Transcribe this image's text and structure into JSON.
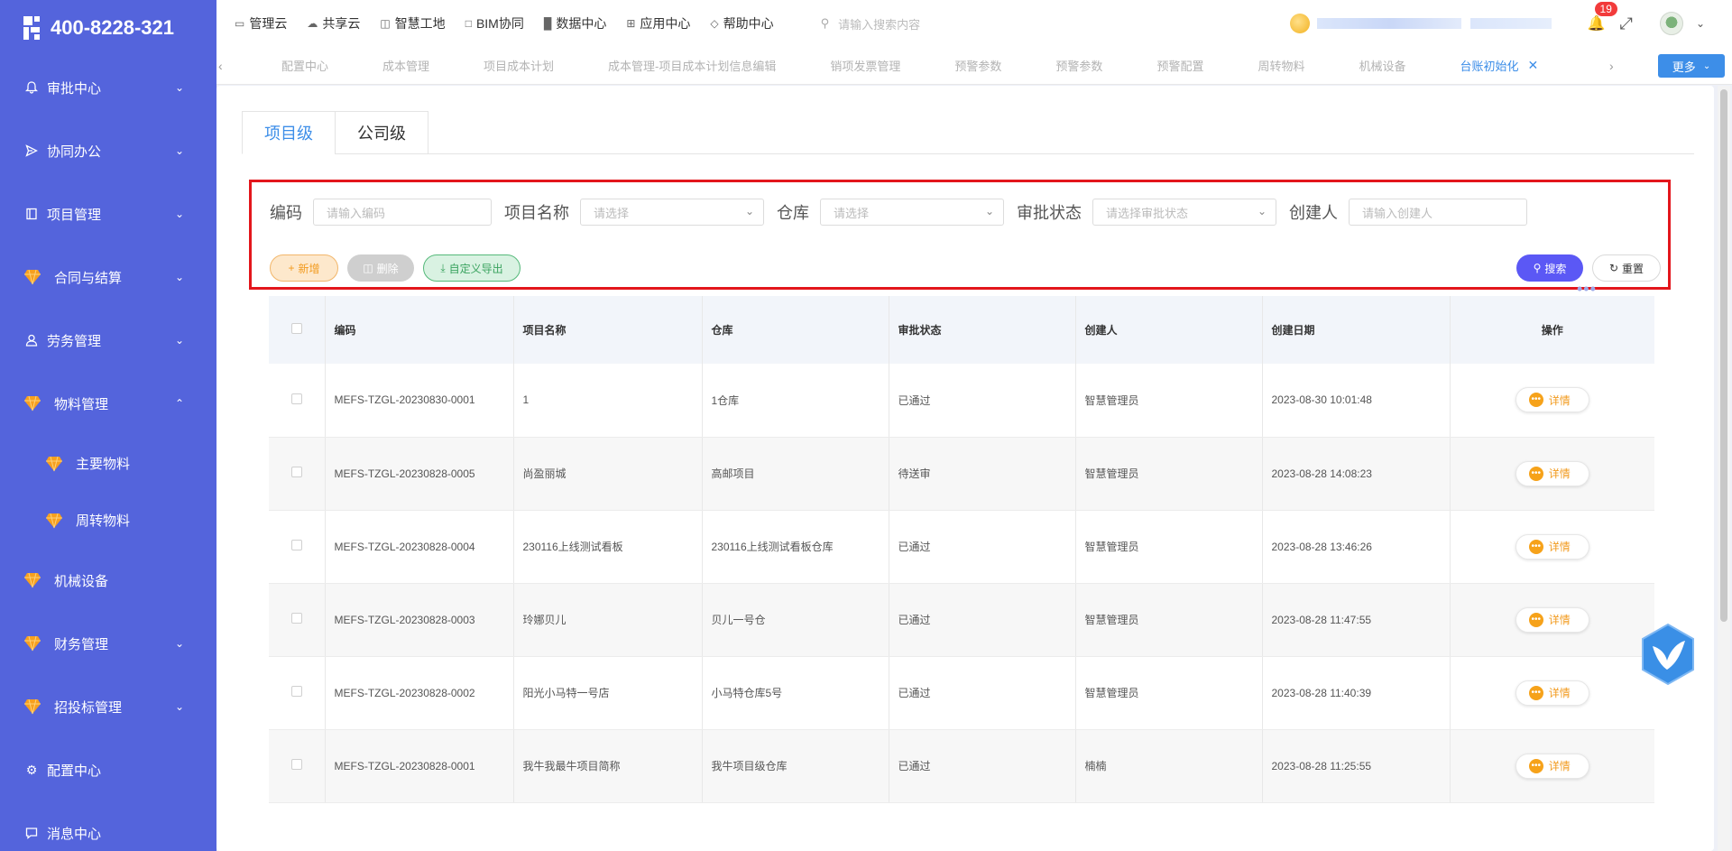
{
  "brand": {
    "phone": "400-8228-321"
  },
  "sidebar": {
    "items": [
      {
        "label": "审批中心",
        "icon": "bell-icon",
        "expanded": false
      },
      {
        "label": "协同办公",
        "icon": "send-icon",
        "expanded": false
      },
      {
        "label": "项目管理",
        "icon": "book-icon",
        "expanded": false
      },
      {
        "label": "合同与结算",
        "icon": "gem-icon",
        "expanded": false
      },
      {
        "label": "劳务管理",
        "icon": "user-icon",
        "expanded": false
      },
      {
        "label": "物料管理",
        "icon": "gem-icon",
        "expanded": true
      },
      {
        "label": "主要物料",
        "icon": "gem-icon",
        "sub": true
      },
      {
        "label": "周转物料",
        "icon": "gem-icon",
        "sub": true
      },
      {
        "label": "机械设备",
        "icon": "gem-icon"
      },
      {
        "label": "财务管理",
        "icon": "gem-icon",
        "expanded": false
      },
      {
        "label": "招投标管理",
        "icon": "gem-icon",
        "expanded": false
      },
      {
        "label": "配置中心",
        "icon": "gear-icon"
      },
      {
        "label": "消息中心",
        "icon": "message-icon"
      }
    ]
  },
  "topnav": {
    "items": [
      "管理云",
      "共享云",
      "智慧工地",
      "BIM协同",
      "数据中心",
      "应用中心",
      "帮助中心"
    ],
    "search_placeholder": "请输入搜索内容",
    "notification_count": "19"
  },
  "tabstrip": {
    "tabs": [
      "配置中心",
      "成本管理",
      "项目成本计划",
      "成本管理-项目成本计划信息编辑",
      "销项发票管理",
      "预警参数",
      "预警参数",
      "预警配置",
      "周转物料",
      "机械设备",
      "台账初始化"
    ],
    "active_index": 10,
    "more_label": "更多"
  },
  "level_tabs": [
    "项目级",
    "公司级"
  ],
  "filters": {
    "code_label": "编码",
    "code_placeholder": "请输入编码",
    "project_label": "项目名称",
    "project_placeholder": "请选择",
    "warehouse_label": "仓库",
    "warehouse_placeholder": "请选择",
    "status_label": "审批状态",
    "status_placeholder": "请选择审批状态",
    "creator_label": "创建人",
    "creator_placeholder": "请输入创建人"
  },
  "actions": {
    "new": "新增",
    "delete": "删除",
    "export": "自定义导出",
    "search": "搜索",
    "reset": "重置"
  },
  "table": {
    "headers": [
      "编码",
      "项目名称",
      "仓库",
      "审批状态",
      "创建人",
      "创建日期",
      "操作"
    ],
    "detail_label": "详情",
    "rows": [
      {
        "code": "MEFS-TZGL-20230830-0001",
        "project": "1",
        "warehouse": "1仓库",
        "status": "已通过",
        "creator": "智慧管理员",
        "date": "2023-08-30 10:01:48"
      },
      {
        "code": "MEFS-TZGL-20230828-0005",
        "project": "尚盈丽城",
        "warehouse": "高邮项目",
        "status": "待送审",
        "creator": "智慧管理员",
        "date": "2023-08-28 14:08:23"
      },
      {
        "code": "MEFS-TZGL-20230828-0004",
        "project": "230116上线测试看板",
        "warehouse": "230116上线测试看板仓库",
        "status": "已通过",
        "creator": "智慧管理员",
        "date": "2023-08-28 13:46:26"
      },
      {
        "code": "MEFS-TZGL-20230828-0003",
        "project": "玲娜贝儿",
        "warehouse": "贝儿一号仓",
        "status": "已通过",
        "creator": "智慧管理员",
        "date": "2023-08-28 11:47:55"
      },
      {
        "code": "MEFS-TZGL-20230828-0002",
        "project": "阳光小马特一号店",
        "warehouse": "小马特仓库5号",
        "status": "已通过",
        "creator": "智慧管理员",
        "date": "2023-08-28 11:40:39"
      },
      {
        "code": "MEFS-TZGL-20230828-0001",
        "project": "我牛我最牛项目简称",
        "warehouse": "我牛项目级仓库",
        "status": "已通过",
        "creator": "楠楠",
        "date": "2023-08-28 11:25:55"
      }
    ]
  },
  "colors": {
    "sidebar": "#5464dc",
    "accent": "#3d8ee8",
    "highlight_border": "#e3161c",
    "search_button": "#5b58f5"
  }
}
